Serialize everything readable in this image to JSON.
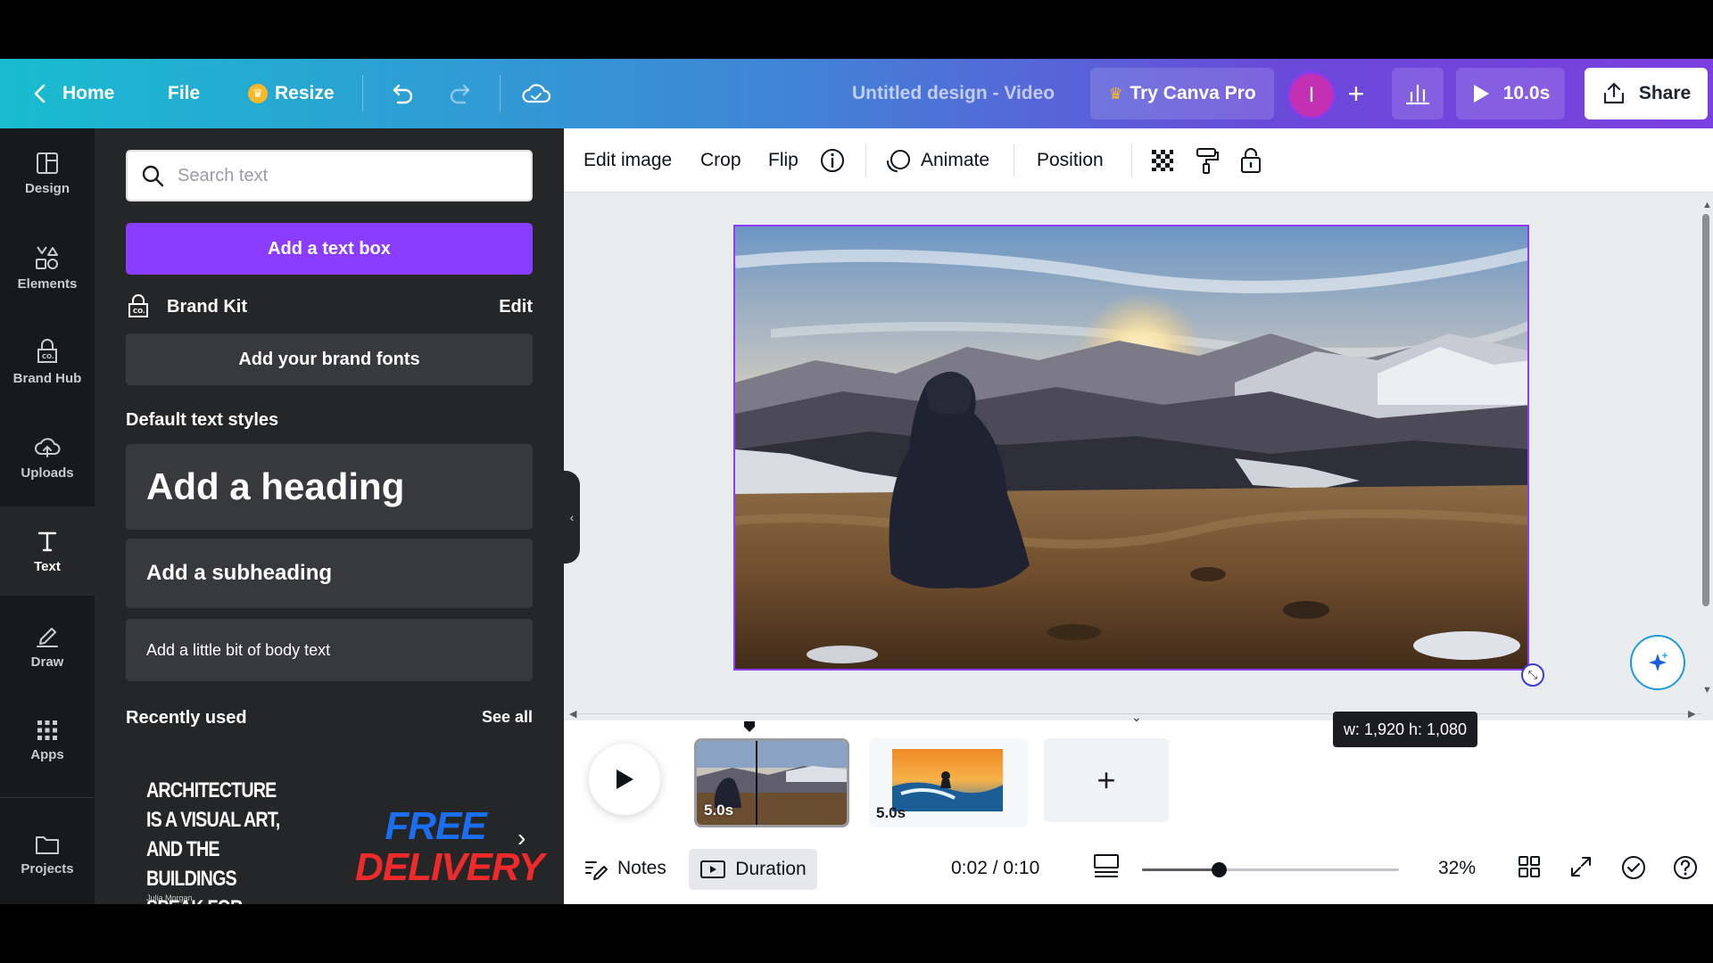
{
  "topbar": {
    "home": "Home",
    "file": "File",
    "resize": "Resize",
    "title": "Untitled design - Video",
    "try_pro": "Try Canva Pro",
    "avatar_initial": "I",
    "play_duration": "10.0s",
    "share": "Share"
  },
  "rail": {
    "design": "Design",
    "elements": "Elements",
    "brand_hub": "Brand Hub",
    "uploads": "Uploads",
    "text": "Text",
    "draw": "Draw",
    "apps": "Apps",
    "projects": "Projects"
  },
  "panel": {
    "search_placeholder": "Search text",
    "add_text_box": "Add a text box",
    "brand_kit": "Brand Kit",
    "brand_kit_edit": "Edit",
    "add_brand_fonts": "Add your brand fonts",
    "default_styles_heading": "Default text styles",
    "heading": "Add a heading",
    "subheading": "Add a subheading",
    "body": "Add a little bit of body text",
    "recently_used": "Recently used",
    "see_all": "See all",
    "recent": {
      "architecture_quote": "ARCHITECTURE IS A VISUAL ART, AND THE BUILDINGS SPEAK FOR THEMSELVES.",
      "architecture_author": "Julia Morgan",
      "free": "FREE",
      "delivery": "DELIVERY"
    }
  },
  "context_bar": {
    "edit_image": "Edit image",
    "crop": "Crop",
    "flip": "Flip",
    "animate": "Animate",
    "position": "Position"
  },
  "canvas": {
    "size_tooltip": "w: 1,920 h: 1,080"
  },
  "timeline": {
    "clips": [
      {
        "duration": "5.0s"
      },
      {
        "duration": "5.0s"
      }
    ],
    "add_page": "+"
  },
  "bottom_bar": {
    "notes": "Notes",
    "duration": "Duration",
    "time": "0:02 / 0:10",
    "zoom": "32%",
    "zoom_level": 0.3
  },
  "colors": {
    "accent": "#8b3dff",
    "topbar_start": "#18bcd0",
    "topbar_end": "#7b3fe0",
    "panel_bg": "#252628",
    "rail_bg": "#18191b"
  }
}
